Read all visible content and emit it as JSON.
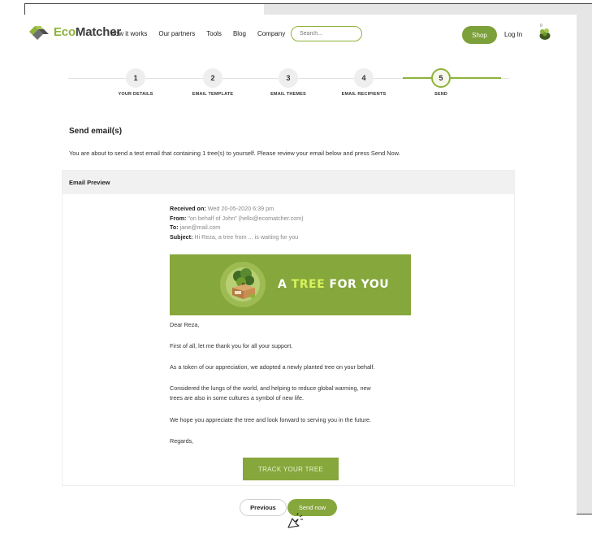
{
  "header": {
    "logo_eco": "Eco",
    "logo_matcher": "Matcher",
    "nav": [
      "How it works",
      "Our partners",
      "Tools",
      "Blog",
      "Company"
    ],
    "search_placeholder": "Search...",
    "shop_label": "Shop",
    "login_label": "Log In",
    "cart_count": "0"
  },
  "stepper": {
    "active_step": 5,
    "steps": [
      {
        "number": "1",
        "label": "YOUR DETAILS"
      },
      {
        "number": "2",
        "label": "EMAIL TEMPLATE"
      },
      {
        "number": "3",
        "label": "EMAIL THEMES"
      },
      {
        "number": "4",
        "label": "EMAIL RECIPIENTS"
      },
      {
        "number": "5",
        "label": "SEND"
      }
    ]
  },
  "content": {
    "title": "Send email(s)",
    "intro": "You are about to send a test email that containing 1 tree(s) to yourself. Please review your email below and press Send Now."
  },
  "preview": {
    "header": "Email Preview",
    "received_label": "Received on:",
    "received_value": "Wed 20-05-2020 6:39 pm",
    "from_label": "From:",
    "from_value": "\"on behalf of John\" (hello@ecomatcher.com)",
    "to_label": "To:",
    "to_value": "jane@mail.com",
    "subject_label": "Subject:",
    "subject_value": "Hi Reza, a tree from ... is waiting for you",
    "banner_a": "A ",
    "banner_tree": "TREE",
    "banner_rest": " FOR YOU",
    "paragraphs": [
      "Dear Reza,",
      "First of all, let me thank you for all your support.",
      "As a token of our appreciation, we adopted a newly planted tree on your behalf.",
      "Considered the lungs of the world, and helping to reduce global warming, new",
      "trees are also in some cultures a symbol of new life.",
      "We hope you appreciate the tree and look forward to serving you in the future.",
      "Regards,"
    ],
    "track_label": "TRACK YOUR TREE"
  },
  "actions": {
    "previous_label": "Previous",
    "send_label": "Send now"
  },
  "colors": {
    "brand_green": "#86a73b",
    "accent_light": "#d7f25a"
  }
}
